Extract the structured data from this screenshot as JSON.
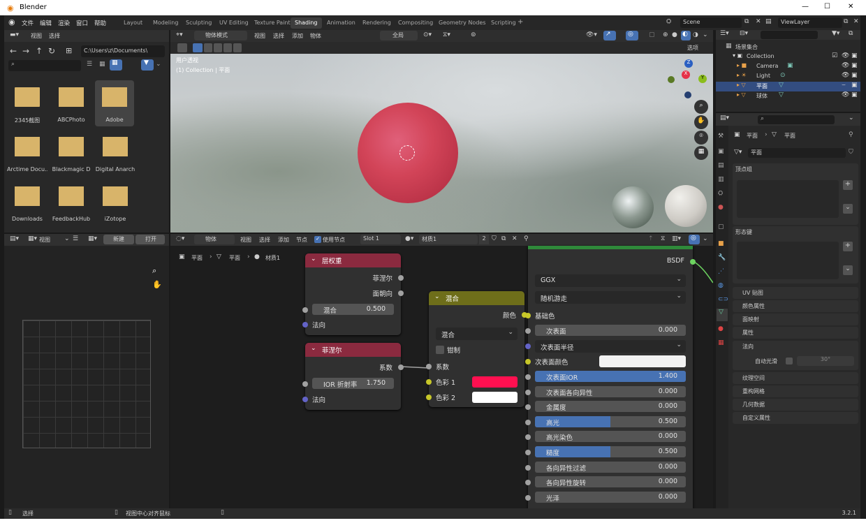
{
  "titlebar": {
    "title": "Blender",
    "min": "—",
    "max": "☐",
    "close": "✕"
  },
  "menu": [
    "文件",
    "编辑",
    "渲染",
    "窗口",
    "帮助"
  ],
  "tabs": [
    {
      "label": "Layout",
      "active": false
    },
    {
      "label": "Modeling",
      "active": false
    },
    {
      "label": "Sculpting",
      "active": false
    },
    {
      "label": "UV Editing",
      "active": false
    },
    {
      "label": "Texture Paint",
      "active": false
    },
    {
      "label": "Shading",
      "active": true
    },
    {
      "label": "Animation",
      "active": false
    },
    {
      "label": "Rendering",
      "active": false
    },
    {
      "label": "Compositing",
      "active": false
    },
    {
      "label": "Geometry Nodes",
      "active": false
    },
    {
      "label": "Scripting",
      "active": false
    }
  ],
  "add_tab": "+",
  "scene": {
    "name": "Scene",
    "viewlayer": "ViewLayer"
  },
  "filebrowser": {
    "menu": [
      "视图",
      "选择"
    ],
    "path": "C:\\Users\\z\\Documents\\",
    "items": [
      {
        "name": "2345截图",
        "selected": false
      },
      {
        "name": "ABCPhoto",
        "selected": false
      },
      {
        "name": "Adobe",
        "selected": true
      },
      {
        "name": "Arctime Docu...",
        "selected": false
      },
      {
        "name": "Blackmagic D",
        "selected": false
      },
      {
        "name": "Digital Anarch",
        "selected": false
      },
      {
        "name": "Downloads",
        "selected": false
      },
      {
        "name": "FeedbackHub",
        "selected": false
      },
      {
        "name": "iZotope",
        "selected": false
      }
    ]
  },
  "viewport": {
    "mode": "物体模式",
    "menu": [
      "视图",
      "选择",
      "添加",
      "物体"
    ],
    "transform": "全局",
    "options": "选项",
    "overlay_line1": "用户透视",
    "overlay_line2": "(1) Collection | 平面",
    "gizmo": {
      "x": "X",
      "y": "Y",
      "z": "Z"
    }
  },
  "outliner": {
    "root": "场景集合",
    "items": [
      {
        "name": "Collection",
        "selected": false
      },
      {
        "name": "Camera",
        "selected": false
      },
      {
        "name": "Light",
        "selected": false
      },
      {
        "name": "平面",
        "selected": true
      },
      {
        "name": "球体",
        "selected": false
      }
    ]
  },
  "properties": {
    "breadcrumb_obj": "平面",
    "breadcrumb_data": "平面",
    "mesh_name": "平面",
    "vertex_groups": "顶点组",
    "shape_keys": "形态键",
    "sections": [
      "UV 贴图",
      "颜色属性",
      "面映射",
      "属性"
    ],
    "normals": "法向",
    "auto_smooth": "自动光滑",
    "auto_smooth_angle": "30°",
    "sections2": [
      "纹理空间",
      "重构网格",
      "几何数据",
      "自定义属性"
    ]
  },
  "image_editor": {
    "view": "视图",
    "new": "新建",
    "open": "打开"
  },
  "node_editor": {
    "type": "物体",
    "menu": [
      "视图",
      "选择",
      "添加",
      "节点"
    ],
    "use_nodes": "使用节点",
    "slot": "Slot 1",
    "material": "材质1",
    "users": "2",
    "breadcrumb": [
      "平面",
      "平面",
      "材质1"
    ]
  },
  "nodes": {
    "layer_weight": {
      "title": "层权重",
      "out1": "菲涅尔",
      "out2": "面朝向",
      "blend_label": "混合",
      "blend_value": "0.500",
      "normal": "法向"
    },
    "fresnel": {
      "title": "菲涅尔",
      "out": "系数",
      "ior_label": "IOR 折射率",
      "ior_value": "1.750",
      "normal": "法向"
    },
    "mix": {
      "title": "混合",
      "out": "颜色",
      "blend": "混合",
      "clamp": "钳制",
      "fac": "系数",
      "color1": "色彩 1",
      "color2": "色彩 2",
      "color1_hex": "#ff1050",
      "color2_hex": "#ffffff"
    },
    "bsdf": {
      "out": "BSDF",
      "distribution": "GGX",
      "subsurface_method": "随机游走",
      "base_color": "基础色",
      "subsurface": {
        "label": "次表面",
        "value": "0.000"
      },
      "subsurface_radius": "次表面半径",
      "subsurface_color": "次表面颜色",
      "rows": [
        {
          "label": "次表面IOR",
          "value": "1.400",
          "fill": 1.0
        },
        {
          "label": "次表面各向异性",
          "value": "0.000",
          "fill": 0
        },
        {
          "label": "金属度",
          "value": "0.000",
          "fill": 0
        },
        {
          "label": "高光",
          "value": "0.500",
          "fill": 0.5
        },
        {
          "label": "高光染色",
          "value": "0.000",
          "fill": 0
        },
        {
          "label": "糙度",
          "value": "0.500",
          "fill": 0.5
        },
        {
          "label": "各向异性过滤",
          "value": "0.000",
          "fill": 0
        },
        {
          "label": "各向异性旋转",
          "value": "0.000",
          "fill": 0
        },
        {
          "label": "光泽",
          "value": "0.000",
          "fill": 0
        }
      ]
    }
  },
  "statusbar": {
    "left": "选择",
    "mid": "视图中心对齐鼠标",
    "version": "3.2.1"
  }
}
